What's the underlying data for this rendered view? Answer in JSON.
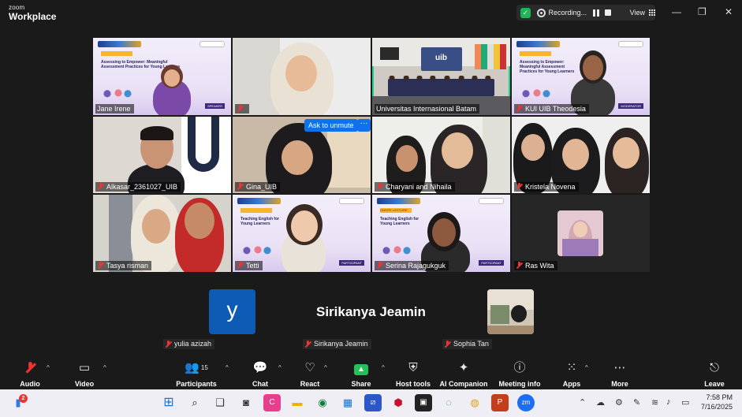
{
  "window": {
    "brand_small": "zoom",
    "brand_big": "Workplace",
    "recording_label": "Recording...",
    "view_label": "View"
  },
  "participants": {
    "row1": [
      "Jane Irene",
      "",
      "Universitas Internasional Batam",
      "KUI UIB Theodesia"
    ],
    "row2": [
      "Alkasar_2361027_UIB",
      "Gina_UIB",
      "Charyani and Nihaila",
      "Kristela Novena"
    ],
    "row3": [
      "Tasya risman",
      "Tetti",
      "Serina Rajagukguk",
      "Ras Wita"
    ],
    "row4": [
      "yulia azizah",
      "Sirikanya Jeamin",
      "Sophia Tan"
    ]
  },
  "avatar_letter": "y",
  "featured_name": "Sirikanya Jeamin",
  "unmute_button": "Ask to unmute",
  "more_button": "···",
  "slides": {
    "tag": "ONSITE LECTURE",
    "title_1": "Assessing to Empower: Meaningful Assessment Practices for Young Learners",
    "title_2": "Teaching English for Young Learners",
    "role_speaker": "SPEAKER",
    "role_moderator": "MODERATOR",
    "role_participant": "PARTICIPANT"
  },
  "toolbar": {
    "audio": "Audio",
    "video": "Video",
    "participants": "Participants",
    "participants_count": "15",
    "chat": "Chat",
    "react": "React",
    "share": "Share",
    "host_tools": "Host tools",
    "ai_companion": "AI Companion",
    "meeting_info": "Meeting info",
    "apps": "Apps",
    "more": "More",
    "leave": "Leave"
  },
  "taskbar": {
    "time": "7:58 PM",
    "date": "7/16/2025",
    "notification_count": "2"
  },
  "colors": {
    "zoom_blue": "#0e72ed",
    "active_speaker_border": "#1fd18b",
    "muted_red": "#e33333",
    "share_green": "#24c15b",
    "avatar_blue": "#0d5bb5"
  }
}
